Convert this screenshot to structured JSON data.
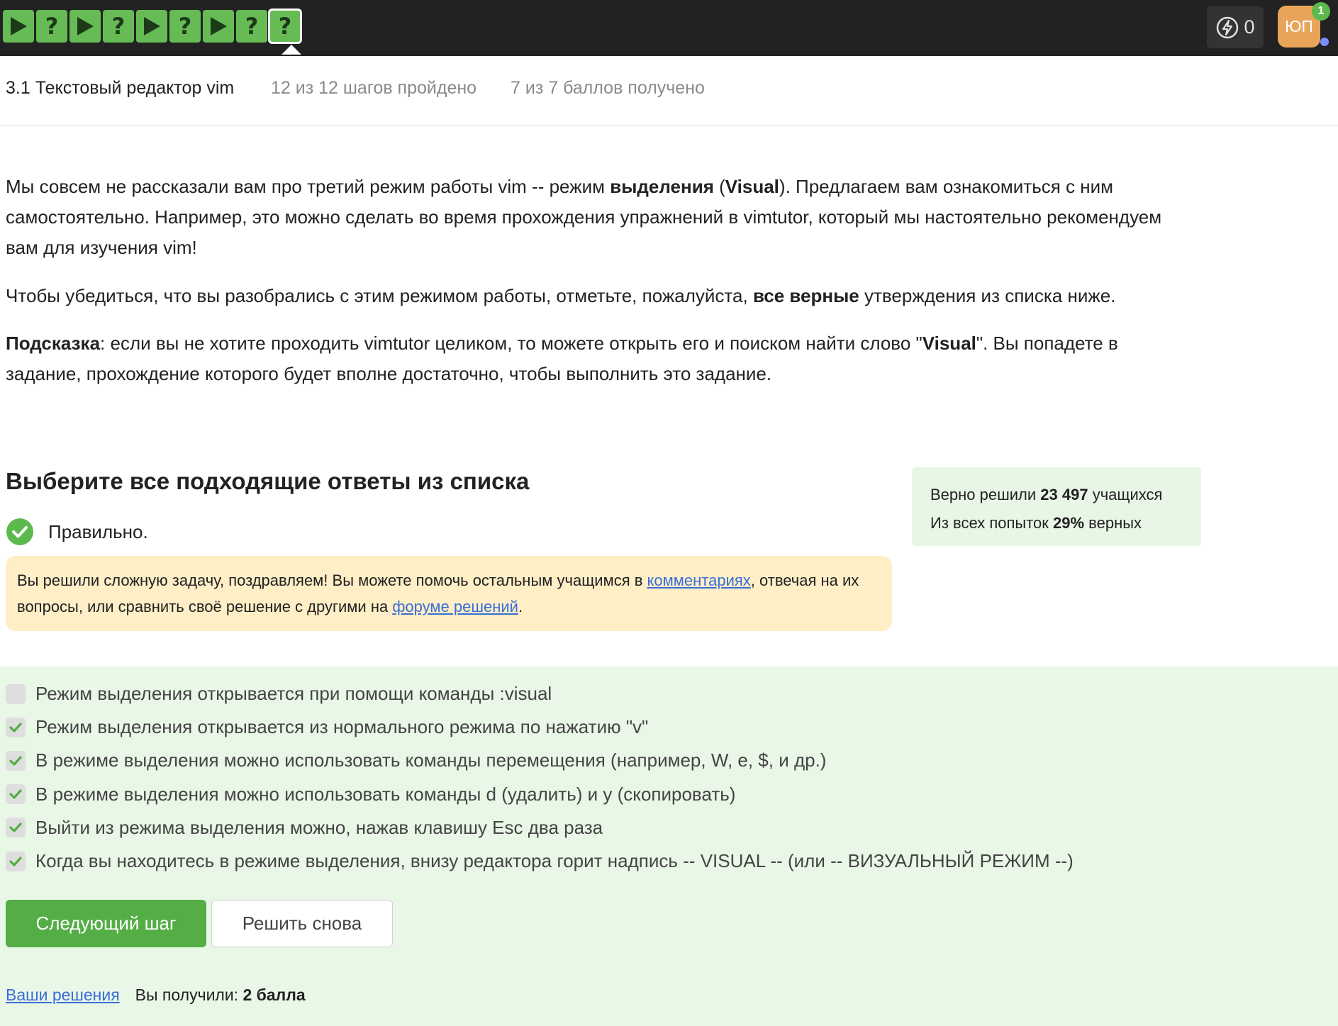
{
  "topbar": {
    "steps": [
      {
        "type": "video"
      },
      {
        "type": "quiz",
        "symbol": "?"
      },
      {
        "type": "video"
      },
      {
        "type": "quiz",
        "symbol": "?"
      },
      {
        "type": "video"
      },
      {
        "type": "quiz",
        "symbol": "?"
      },
      {
        "type": "video"
      },
      {
        "type": "quiz",
        "symbol": "?"
      },
      {
        "type": "quiz",
        "symbol": "?",
        "active": true
      }
    ],
    "energy_count": "0",
    "avatar_initials": "ЮП",
    "notification_count": "1",
    "icons": {
      "energy": "lightning-icon",
      "video": "play-icon"
    }
  },
  "lesson": {
    "title": "3.1 Текстовый редактор vim",
    "steps_progress": "12 из 12 шагов пройдено",
    "points_progress": "7 из 7 баллов  получено"
  },
  "content": {
    "p1": {
      "t1": "Мы совсем не рассказали вам про третий режим работы vim -- режим ",
      "b1": "выделения",
      "t2": " (",
      "b2": "Visual",
      "t3": "). Предлагаем вам ознакомиться с ним самостоятельно. Например, это можно сделать во время прохождения упражнений в vimtutor, который мы настоятельно рекомендуем вам для изучения vim!"
    },
    "p2": {
      "t1": "Чтобы убедиться, что вы разобрались с этим режимом работы, отметьте, пожалуйста, ",
      "b1": "все верные",
      "t2": " утверждения из списка ниже."
    },
    "p3": {
      "b1": "Подсказка",
      "t1": ": если вы не хотите проходить vimtutor целиком, то можете открыть его и поиском найти слово \"",
      "b2": "Visual",
      "t2": "\". Вы попадете в задание, прохождение которого будет вполне достаточно, чтобы выполнить это задание."
    }
  },
  "quiz": {
    "title": "Выберите все подходящие ответы из списка",
    "result": "Правильно.",
    "feedback": {
      "t1": "Вы решили сложную задачу, поздравляем! Вы можете помочь остальным учащимся в ",
      "link1": "комментариях",
      "t2": ", отвечая на их вопросы, или сравнить своё решение с другими на ",
      "link2": "форуме решений",
      "t3": "."
    },
    "stats": {
      "line1_pre": "Верно решили ",
      "line1_num": "23 497",
      "line1_post": " учащихся",
      "line2_pre": "Из всех попыток ",
      "line2_num": "29%",
      "line2_post": " верных"
    },
    "options": [
      {
        "label": "Режим выделения открывается при помощи команды :visual",
        "checked": false
      },
      {
        "label": "Режим выделения открывается из нормального режима по нажатию \"v\"",
        "checked": true
      },
      {
        "label": "В режиме выделения можно использовать команды перемещения (например, W, e, $, и др.)",
        "checked": true
      },
      {
        "label": "В режиме выделения можно использовать команды d (удалить) и y (скопировать)",
        "checked": true
      },
      {
        "label": "Выйти из режима выделения можно, нажав клавишу Esc два раза",
        "checked": true
      },
      {
        "label": "Когда вы находитесь в режиме выделения, внизу редактора горит надпись -- VISUAL -- (или -- ВИЗУАЛЬНЫЙ РЕЖИМ --)",
        "checked": true
      }
    ],
    "next_button": "Следующий шаг",
    "retry_button": "Решить снова",
    "solutions_link": "Ваши решения",
    "score_pre": "Вы получили: ",
    "score_value": "2 балла"
  },
  "colors": {
    "topbar": "#222222",
    "step_green": "#66bb55",
    "accent_green": "#54ad45",
    "answers_bg": "#e9f7e7",
    "feedback_bg": "#ffeec6",
    "link": "#3a6ed8"
  }
}
